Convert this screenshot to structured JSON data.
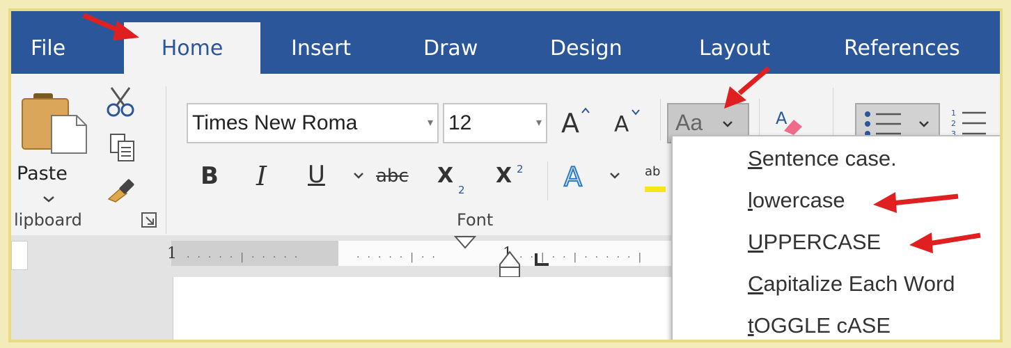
{
  "tabs": [
    {
      "label": "File"
    },
    {
      "label": "Home"
    },
    {
      "label": "Insert"
    },
    {
      "label": "Draw"
    },
    {
      "label": "Design"
    },
    {
      "label": "Layout"
    },
    {
      "label": "References"
    }
  ],
  "clipboard": {
    "paste_label": "Paste",
    "group_label": "lipboard"
  },
  "font": {
    "font_name": "Times New Roma",
    "font_size": "12",
    "grow_label": "A",
    "shrink_label": "A",
    "change_case_label": "Aa",
    "bold_label": "B",
    "italic_label": "I",
    "underline_label": "U",
    "strike_label": "abc",
    "subscript_label": "X",
    "subscript_mark": "2",
    "superscript_label": "X",
    "superscript_mark": "2",
    "effects_label": "A",
    "highlight_label": "ab",
    "group_label": "Font"
  },
  "ruler": {
    "tick_left": "1",
    "tick_mid": "1"
  },
  "change_case_menu": [
    {
      "first": "S",
      "rest": "entence case."
    },
    {
      "first": "l",
      "rest": "owercase"
    },
    {
      "first": "U",
      "rest": "PPERCASE"
    },
    {
      "first": "C",
      "rest": "apitalize Each Word"
    },
    {
      "first": "t",
      "rest": "OGGLE cASE"
    }
  ],
  "colors": {
    "accent": "#2b579a",
    "annotation_arrow": "#e02020"
  }
}
